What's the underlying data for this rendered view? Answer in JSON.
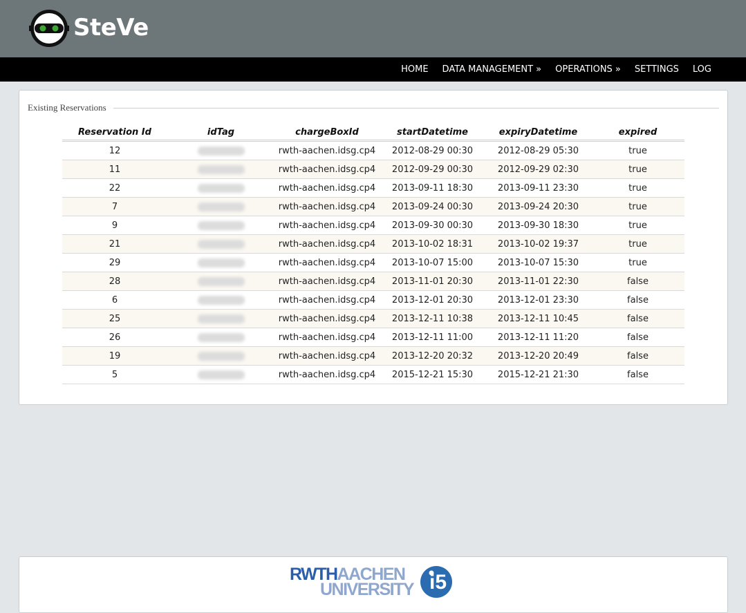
{
  "app": {
    "name": "SteVe"
  },
  "nav": {
    "items": [
      {
        "label": "HOME"
      },
      {
        "label": "DATA MANAGEMENT »"
      },
      {
        "label": "OPERATIONS »"
      },
      {
        "label": "SETTINGS"
      },
      {
        "label": "LOG"
      }
    ]
  },
  "panel": {
    "legend": "Existing Reservations"
  },
  "table": {
    "headers": [
      "Reservation Id",
      "idTag",
      "chargeBoxId",
      "startDatetime",
      "expiryDatetime",
      "expired"
    ],
    "rows": [
      {
        "id": "12",
        "chargeBoxId": "rwth-aachen.idsg.cp4",
        "start": "2012-08-29 00:30",
        "expiry": "2012-08-29 05:30",
        "expired": "true"
      },
      {
        "id": "11",
        "chargeBoxId": "rwth-aachen.idsg.cp4",
        "start": "2012-09-29 00:30",
        "expiry": "2012-09-29 02:30",
        "expired": "true"
      },
      {
        "id": "22",
        "chargeBoxId": "rwth-aachen.idsg.cp4",
        "start": "2013-09-11 18:30",
        "expiry": "2013-09-11 23:30",
        "expired": "true"
      },
      {
        "id": "7",
        "chargeBoxId": "rwth-aachen.idsg.cp4",
        "start": "2013-09-24 00:30",
        "expiry": "2013-09-24 20:30",
        "expired": "true"
      },
      {
        "id": "9",
        "chargeBoxId": "rwth-aachen.idsg.cp4",
        "start": "2013-09-30 00:30",
        "expiry": "2013-09-30 18:30",
        "expired": "true"
      },
      {
        "id": "21",
        "chargeBoxId": "rwth-aachen.idsg.cp4",
        "start": "2013-10-02 18:31",
        "expiry": "2013-10-02 19:37",
        "expired": "true"
      },
      {
        "id": "29",
        "chargeBoxId": "rwth-aachen.idsg.cp4",
        "start": "2013-10-07 15:00",
        "expiry": "2013-10-07 15:30",
        "expired": "true"
      },
      {
        "id": "28",
        "chargeBoxId": "rwth-aachen.idsg.cp4",
        "start": "2013-11-01 20:30",
        "expiry": "2013-11-01 22:30",
        "expired": "false"
      },
      {
        "id": "6",
        "chargeBoxId": "rwth-aachen.idsg.cp4",
        "start": "2013-12-01 20:30",
        "expiry": "2013-12-01 23:30",
        "expired": "false"
      },
      {
        "id": "25",
        "chargeBoxId": "rwth-aachen.idsg.cp4",
        "start": "2013-12-11 10:38",
        "expiry": "2013-12-11 10:45",
        "expired": "false"
      },
      {
        "id": "26",
        "chargeBoxId": "rwth-aachen.idsg.cp4",
        "start": "2013-12-11 11:00",
        "expiry": "2013-12-11 11:20",
        "expired": "false"
      },
      {
        "id": "19",
        "chargeBoxId": "rwth-aachen.idsg.cp4",
        "start": "2013-12-20 20:32",
        "expiry": "2013-12-20 20:49",
        "expired": "false"
      },
      {
        "id": "5",
        "chargeBoxId": "rwth-aachen.idsg.cp4",
        "start": "2015-12-21 15:30",
        "expiry": "2015-12-21 21:30",
        "expired": "false"
      }
    ]
  },
  "footer": {
    "rwth_logo_line1_a": "RWTH",
    "rwth_logo_line1_b": "AACHEN",
    "rwth_logo_line2": "UNIVERSITY",
    "i5_logo_text": "i5",
    "i5_logo_small": "RWTH"
  },
  "colors": {
    "header_bg": "#6d7678",
    "navbar_bg": "#000000",
    "page_bg": "#e3e6e8",
    "row_alt_bg": "#fbf8f1",
    "rwth_blue": "#2b5ea8",
    "rwth_light_blue": "#8fa7cc",
    "logo_green": "#3fa535"
  },
  "icons": {
    "logo": "steve-robot-face-icon",
    "footer_logo_1": "rwth-aachen-university-logo",
    "footer_logo_2": "i5-logo"
  }
}
